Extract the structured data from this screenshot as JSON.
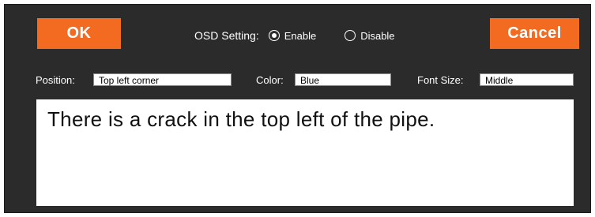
{
  "buttons": {
    "ok_label": "OK",
    "cancel_label": "Cancel"
  },
  "osd": {
    "label": "OSD Setting:",
    "enable_label": "Enable",
    "disable_label": "Disable",
    "selected": "Enable"
  },
  "fields": {
    "position_label": "Position:",
    "position_value": "Top left corner",
    "color_label": "Color:",
    "color_value": "Blue",
    "font_size_label": "Font Size:",
    "font_size_value": "Middle"
  },
  "notes_text": "There is a crack in the top left of the pipe.",
  "colors": {
    "accent": "#f26b21",
    "panel": "#2b2b2b",
    "text_on_panel": "#ffffff"
  }
}
